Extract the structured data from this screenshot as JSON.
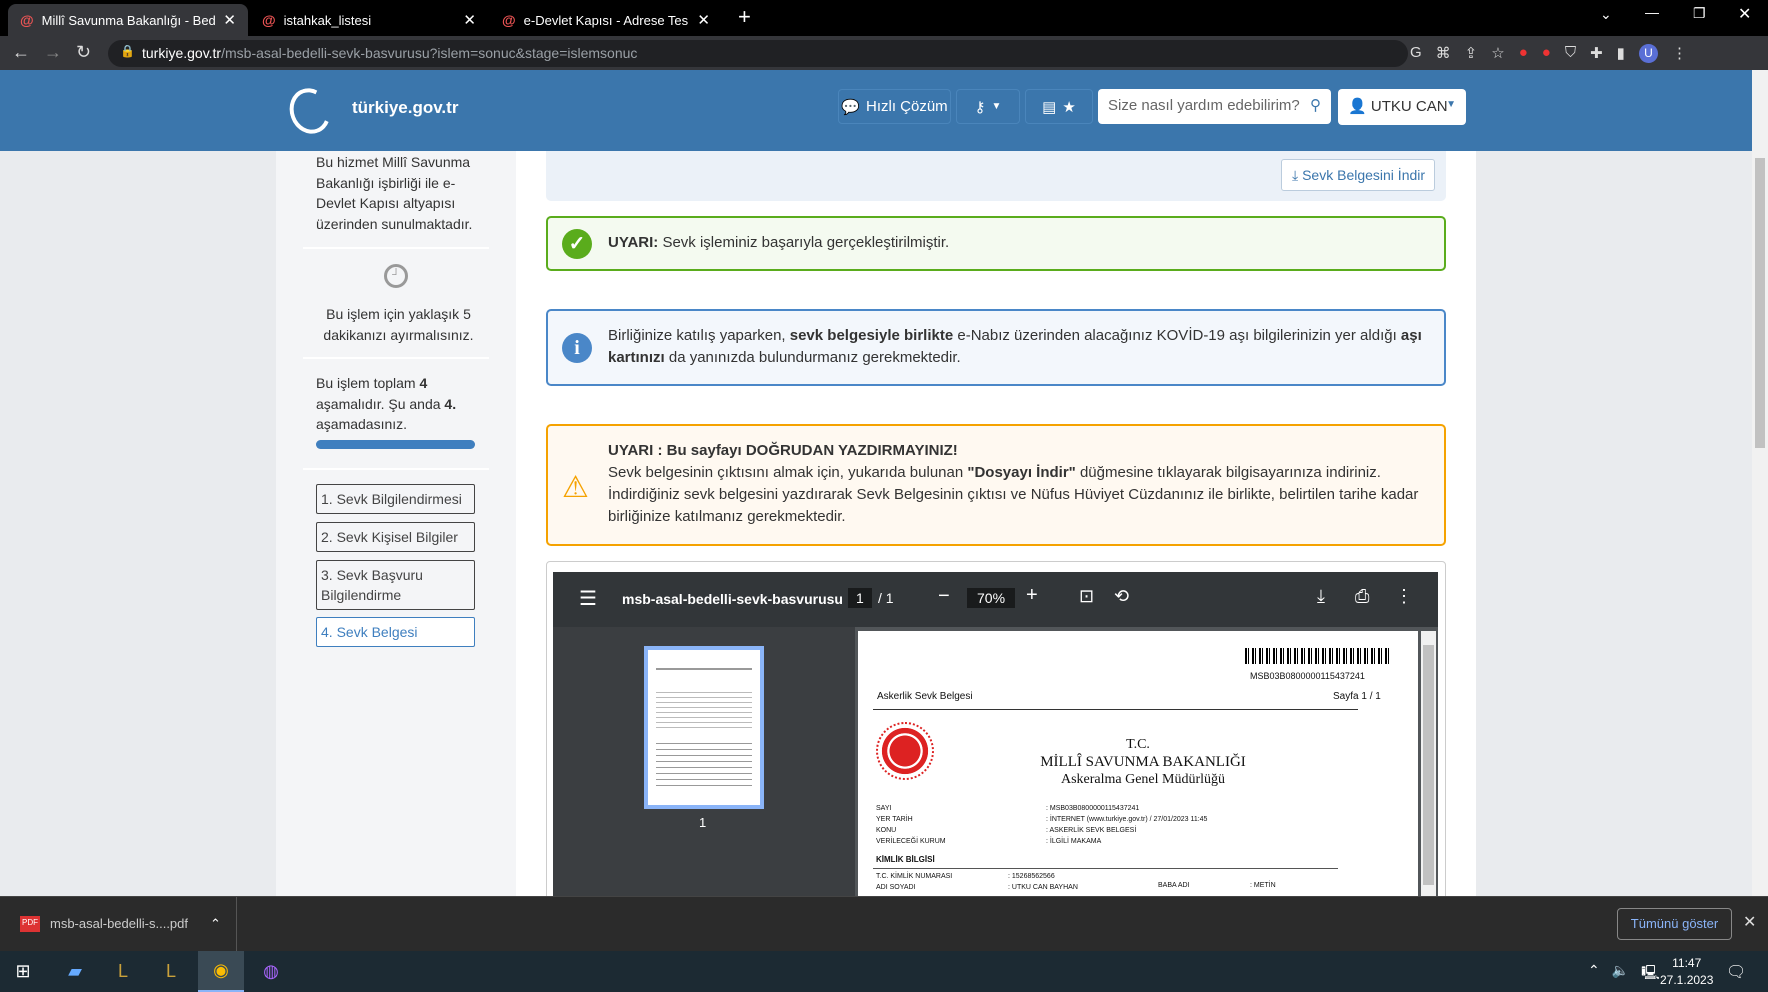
{
  "browser": {
    "tabs": [
      {
        "title": "Millî Savunma Bakanlığı - Bedelli",
        "active": true
      },
      {
        "title": "istahkak_listesi",
        "active": false
      },
      {
        "title": "e-Devlet Kapısı - Adrese Teslim Ş",
        "active": false
      }
    ],
    "url_host": "turkiye.gov.tr",
    "url_path": "/msb-asal-bedelli-sevk-basvurusu?islem=sonuc&stage=islemsonuc",
    "profile_initial": "U"
  },
  "header": {
    "logo": "türkiye.gov.tr",
    "quick_solution": "Hızlı Çözüm",
    "search_placeholder": "Size nasıl yardım edebilirim?",
    "user": "UTKU CAN"
  },
  "sidebar": {
    "service_note": "Bu hizmet Millî Savunma Bakanlığı işbirliği ile e-Devlet Kapısı altyapısı üzerinden sunulmaktadır.",
    "time_note": "Bu işlem için yaklaşık 5 dakikanızı ayırmalısınız.",
    "stage_pre": "Bu işlem toplam ",
    "stage_total": "4",
    "stage_mid": " aşamalıdır. Şu anda ",
    "stage_current": "4.",
    "stage_post": " aşamadasınız.",
    "progress": 1.0,
    "steps": [
      "1. Sevk Bilgilendirmesi",
      "2. Sevk Kişisel Bilgiler",
      "3. Sevk Başvuru Bilgilendirme",
      "4. Sevk Belgesi"
    ]
  },
  "main": {
    "download_button": "Sevk Belgesini İndir",
    "success": {
      "label": "UYARI:",
      "text": " Sevk işleminiz başarıyla gerçekleştirilmiştir."
    },
    "info": {
      "t1": "Birliğinize katılış yaparken, ",
      "b1": "sevk belgesiyle birlikte",
      "t2": " e-Nabız üzerinden alacağınız KOVİD-19 aşı bilgilerinizin yer aldığı ",
      "b2": "aşı kartınızı",
      "t3": " da yanınızda bulundurmanız gerekmektedir."
    },
    "warning": {
      "title": "UYARI : Bu sayfayı DOĞRUDAN YAZDIRMAYINIZ!",
      "t1": "Sevk belgesinin çıktısını almak için, yukarıda bulunan ",
      "b1": "\"Dosyayı İndir\"",
      "t2": " düğmesine tıklayarak bilgisayarınıza indiriniz. İndirdiğiniz sevk belgesini yazdırarak Sevk Belgesinin çıktısı ve Nüfus Hüviyet Cüzdanınız ile birlikte, belirtilen tarihe kadar birliğinize katılmanız gerekmektedir."
    }
  },
  "pdf": {
    "filename": "msb-asal-bedelli-sevk-basvurusu",
    "page": "1",
    "total": "/ 1",
    "zoom": "70%",
    "thumb_label": "1",
    "doc": {
      "barcode": "MSB03B0800000115437241",
      "doc_title": "Askerlik Sevk Belgesi",
      "page_of": "Sayfa 1 / 1",
      "tc": "T.C.",
      "ministry": "MİLLÎ SAVUNMA BAKANLIĞI",
      "directorate": "Askeralma Genel Müdürlüğü",
      "fields": [
        {
          "k": "SAYI",
          "v": ": MSB03B0800000115437241"
        },
        {
          "k": "YER TARİH",
          "v": ": İNTERNET (www.turkiye.gov.tr) / 27/01/2023  11:45"
        },
        {
          "k": "KONU",
          "v": ": ASKERLİK SEVK BELGESİ"
        },
        {
          "k": "VERİLECEĞİ KURUM",
          "v": ": İLGİLİ MAKAMA"
        }
      ],
      "section": "KİMLİK BİLGİSİ",
      "id_label": "T.C. KİMLİK NUMARASI",
      "id_value": ": 15268562566",
      "name_label": "ADI SOYADI",
      "name_value": ": UTKU CAN BAYHAN",
      "father_label": "BABA ADI",
      "father_value": ": METİN"
    }
  },
  "downloads": {
    "file": "msb-asal-bedelli-s....pdf",
    "show_all": "Tümünü göster"
  },
  "taskbar": {
    "time": "11:47",
    "date": "27.1.2023"
  },
  "colors": {
    "header": "#3b76ac",
    "success": "#5aac1c",
    "info": "#4a87c8",
    "warning": "#f5a200"
  }
}
